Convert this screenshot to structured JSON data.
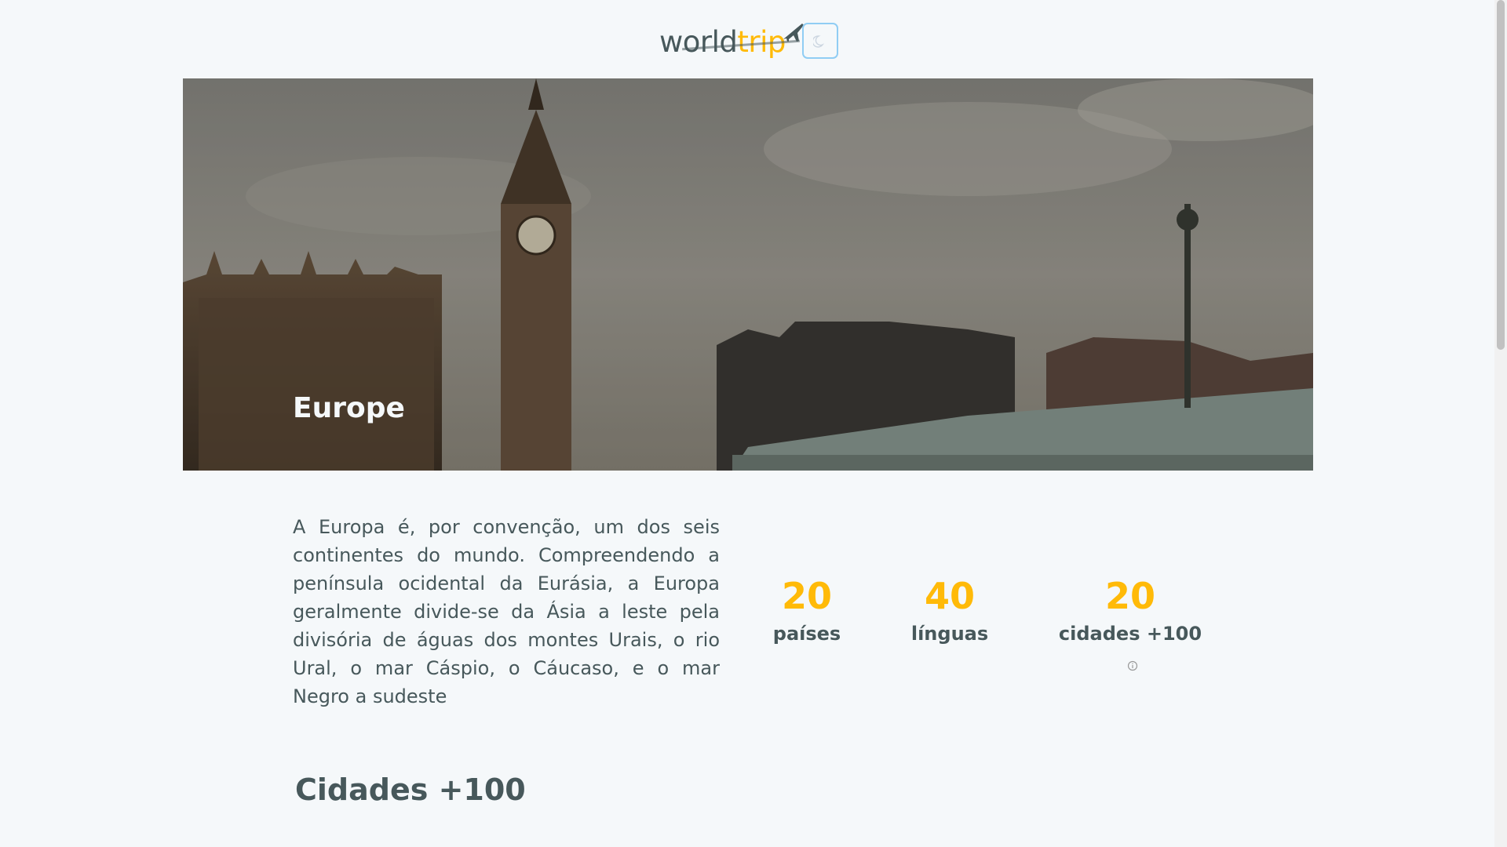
{
  "header": {
    "logo_world": "world",
    "logo_trip": "trip",
    "theme_toggle_icon": "moon-icon"
  },
  "hero": {
    "title": "Europe"
  },
  "description": "A Europa é, por convenção, um dos seis continentes do mundo. Compreendendo a península ocidental da Eurásia, a Europa geralmente divide-se da Ásia a leste pela divisória de águas dos montes Urais, o rio Ural, o mar Cáspio, o Cáucaso, e o mar Negro a sudeste",
  "stats": [
    {
      "value": "20",
      "label": "países"
    },
    {
      "value": "40",
      "label": "línguas"
    },
    {
      "value": "20",
      "label": "cidades +100",
      "icon": "info-icon"
    }
  ],
  "section": {
    "title": "Cidades +100"
  },
  "colors": {
    "accent": "#ffba08",
    "text": "#47585b",
    "background": "#f5f8fa",
    "toggle_border": "#90cdf4"
  }
}
